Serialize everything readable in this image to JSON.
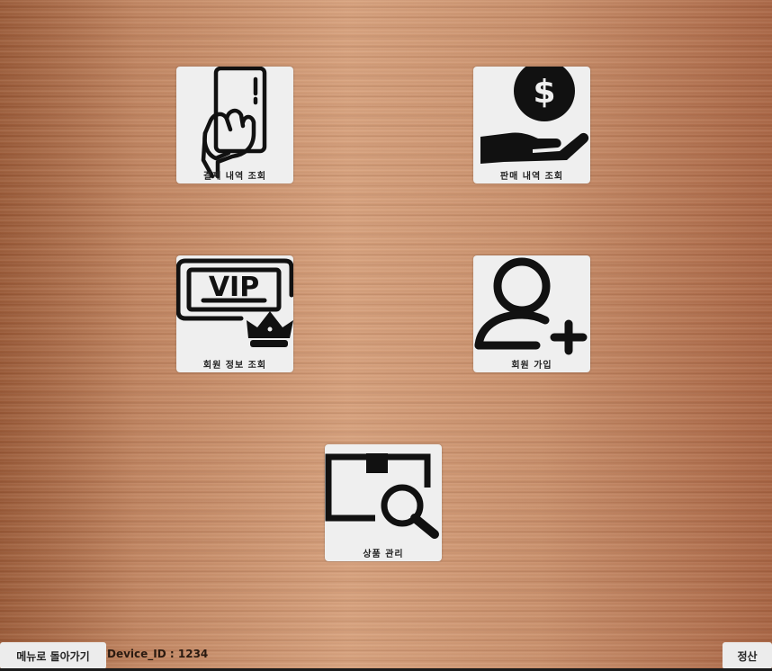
{
  "tiles": {
    "payment_history": {
      "label": "결제 내역 조회",
      "icon": "hand-card-icon"
    },
    "sales_history": {
      "label": "판매 내역 조회",
      "icon": "hand-dollar-icon"
    },
    "member_info": {
      "label": "회원 정보 조회",
      "icon": "vip-card-icon"
    },
    "member_signup": {
      "label": "회원 가입",
      "icon": "add-user-icon"
    },
    "product_manage": {
      "label": "상품 관리",
      "icon": "box-search-icon"
    }
  },
  "footer": {
    "back_label": "메뉴로 돌아가기",
    "device_id": "Device_ID : 1234",
    "settle_label": "정산"
  }
}
